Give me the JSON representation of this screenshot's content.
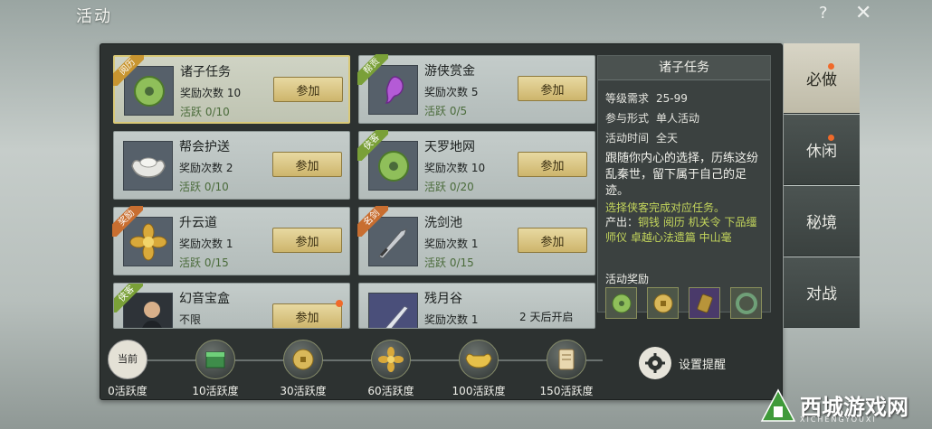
{
  "window": {
    "title": "活动",
    "help_icon": "?",
    "close_icon": "✕"
  },
  "cards": [
    {
      "name": "诸子任务",
      "reward": "奖励次数 10",
      "active": "活跃 0/10",
      "tag": "阅历",
      "button": "参加",
      "icon": "jade-coin-icon"
    },
    {
      "name": "游侠赏金",
      "reward": "奖励次数 5",
      "active": "活跃 0/5",
      "tag": "帮贡",
      "button": "参加",
      "icon": "purple-gem-icon"
    },
    {
      "name": "帮会护送",
      "reward": "奖励次数 2",
      "active": "活跃 0/10",
      "tag": "",
      "button": "参加",
      "icon": "silver-ingot-icon"
    },
    {
      "name": "天罗地网",
      "reward": "奖励次数 10",
      "active": "活跃 0/20",
      "tag": "侠客",
      "button": "参加",
      "icon": "jade-coin-icon"
    },
    {
      "name": "升云道",
      "reward": "奖励次数 1",
      "active": "活跃 0/15",
      "tag": "奖励",
      "button": "参加",
      "icon": "gold-flower-icon"
    },
    {
      "name": "洗剑池",
      "reward": "奖励次数 1",
      "active": "活跃 0/15",
      "tag": "名剑",
      "button": "参加",
      "icon": "sword-icon"
    },
    {
      "name": "幻音宝盒",
      "reward": "不限",
      "active": "",
      "tag": "侠客",
      "button": "参加",
      "icon": "warrior-portrait-icon"
    },
    {
      "name": "残月谷",
      "reward": "奖励次数 1",
      "active": "",
      "tag": "",
      "button": "",
      "open_text": "2 天后开启",
      "icon": "blade-icon"
    }
  ],
  "detail": {
    "title": "诸子任务",
    "level_label": "等级需求",
    "level_value": "25-99",
    "mode_label": "参与形式",
    "mode_value": "单人活动",
    "time_label": "活动时间",
    "time_value": "全天",
    "description": "跟随你内心的选择，历练这纷乱秦世，留下属于自己的足迹。",
    "hint": "选择侠客完成对应任务。",
    "output_label": "产出：",
    "output_items": "铜钱 阅历 机关令 下品缰师仪 卓越心法遗篇 中山毫",
    "reward_label": "活动奖励",
    "rewards": [
      "jade-coin-icon",
      "gold-coin-icon",
      "purple-token-icon",
      "jade-ring-icon"
    ]
  },
  "tabs": [
    {
      "label": "必做",
      "active": true,
      "badge": true
    },
    {
      "label": "休闲",
      "active": false,
      "badge": true
    },
    {
      "label": "秘境",
      "active": false,
      "badge": false
    },
    {
      "label": "对战",
      "active": false,
      "badge": false
    }
  ],
  "progress": {
    "current_label": "当前",
    "milestones": [
      {
        "label": "0活跃度"
      },
      {
        "label": "10活跃度",
        "icon": "jade-box-icon"
      },
      {
        "label": "30活跃度",
        "icon": "gold-coin-icon"
      },
      {
        "label": "60活跃度",
        "icon": "gold-flower-icon"
      },
      {
        "label": "100活跃度",
        "icon": "gold-ingot-icon"
      },
      {
        "label": "150活跃度",
        "icon": "scroll-icon"
      }
    ],
    "settings_label": "设置提醒"
  },
  "watermark": {
    "text": "西城游戏网",
    "sub": "XICHENGYOUXI"
  },
  "colors": {
    "accent_gold": "#cdb56c",
    "notify_dot": "#f06a2a",
    "hint_green": "#c4d65c"
  }
}
